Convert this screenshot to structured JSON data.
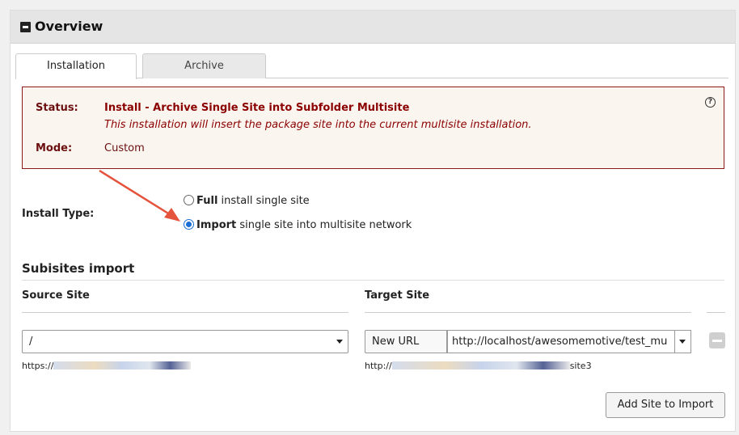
{
  "panel": {
    "title": "Overview"
  },
  "tabs": [
    {
      "label": "Installation"
    },
    {
      "label": "Archive"
    }
  ],
  "status": {
    "status_label": "Status:",
    "status_title": "Install - Archive Single Site into Subfolder Multisite",
    "status_desc": "This installation will insert the package site into the current multisite installation.",
    "mode_label": "Mode:",
    "mode_value": "Custom",
    "help_glyph": "?"
  },
  "install_type": {
    "label": "Install Type:",
    "options": [
      {
        "bold": "Full",
        "rest": " install single site",
        "checked": false
      },
      {
        "bold": "Import",
        "rest": " single site into multisite network",
        "checked": true
      }
    ]
  },
  "subsites": {
    "title": "Subisites import",
    "source_header": "Source Site",
    "target_header": "Target Site",
    "source_value": "/",
    "source_url_prefix": "https://",
    "target_mode": "New URL",
    "target_value": "http://localhost/awesomemotive/test_mu",
    "target_url_prefix": "http://",
    "target_url_suffix": "site3",
    "add_button": "Add Site to Import"
  },
  "colors": {
    "accent": "#1a6fd6",
    "status_border": "#8b1a1a",
    "status_text": "#8b0000",
    "arrow": "#e5533d"
  }
}
